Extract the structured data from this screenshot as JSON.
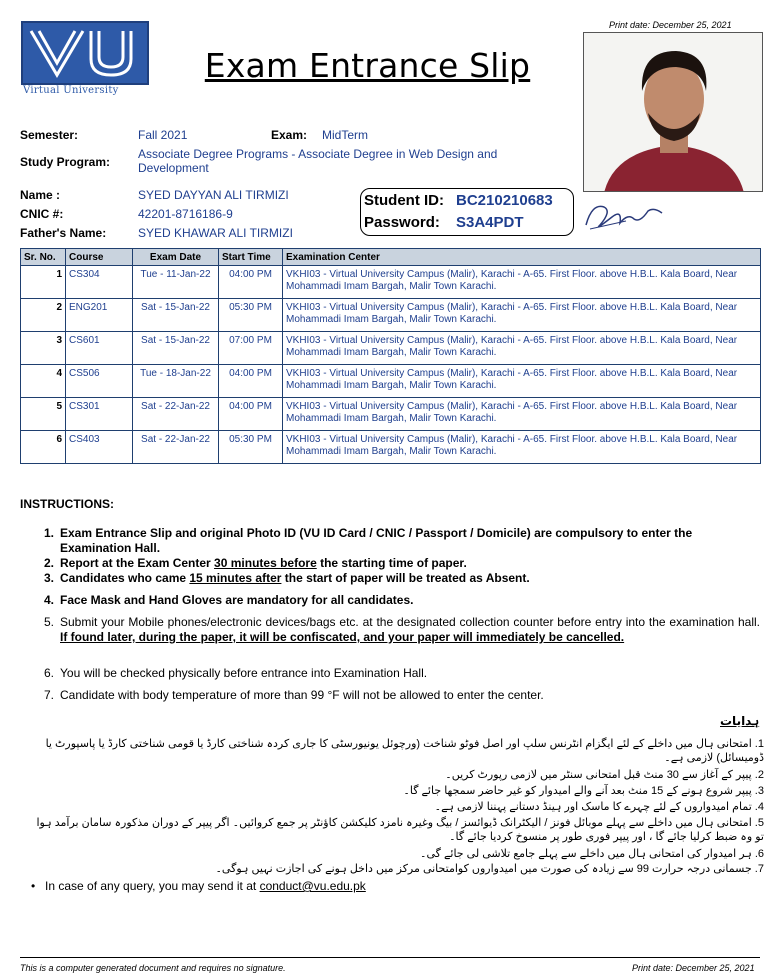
{
  "print_date": "Print date: December 25, 2021",
  "logo": {
    "caption": "Virtual University",
    "color": "#2e5aa8"
  },
  "title": "Exam Entrance Slip",
  "semester": {
    "label": "Semester:",
    "value": "Fall 2021"
  },
  "exam": {
    "label": "Exam:",
    "value": "MidTerm"
  },
  "study_program": {
    "label": "Study Program:",
    "value": "Associate Degree Programs - Associate Degree in Web Design and Development"
  },
  "name": {
    "label": "Name :",
    "value": "SYED DAYYAN ALI TIRMIZI"
  },
  "cnic": {
    "label": "CNIC #:",
    "value": "42201-8716186-9"
  },
  "father_name": {
    "label": "Father's Name:",
    "value": "SYED KHAWAR ALI TIRMIZI"
  },
  "student_id": {
    "label": "Student ID:",
    "value": "BC210210683"
  },
  "password": {
    "label": "Password:",
    "value": "S3A4PDT"
  },
  "table": {
    "headers": [
      "Sr. No.",
      "Course",
      "Exam Date",
      "Start Time",
      "Examination Center"
    ],
    "rows": [
      {
        "sr": "1",
        "course": "CS304",
        "date": "Tue - 11-Jan-22",
        "time": "04:00 PM",
        "center": "VKHI03 - Virtual University Campus (Malir), Karachi - A-65. First Floor. above H.B.L. Kala Board, Near Mohammadi Imam Bargah, Malir Town Karachi."
      },
      {
        "sr": "2",
        "course": "ENG201",
        "date": "Sat - 15-Jan-22",
        "time": "05:30 PM",
        "center": "VKHI03 - Virtual University Campus (Malir), Karachi - A-65. First Floor. above H.B.L. Kala Board, Near Mohammadi Imam Bargah, Malir Town Karachi."
      },
      {
        "sr": "3",
        "course": "CS601",
        "date": "Sat - 15-Jan-22",
        "time": "07:00 PM",
        "center": "VKHI03 - Virtual University Campus (Malir), Karachi - A-65. First Floor. above H.B.L. Kala Board, Near Mohammadi Imam Bargah, Malir Town Karachi."
      },
      {
        "sr": "4",
        "course": "CS506",
        "date": "Tue - 18-Jan-22",
        "time": "04:00 PM",
        "center": "VKHI03 - Virtual University Campus (Malir), Karachi - A-65. First Floor. above H.B.L. Kala Board, Near Mohammadi Imam Bargah, Malir Town Karachi."
      },
      {
        "sr": "5",
        "course": "CS301",
        "date": "Sat - 22-Jan-22",
        "time": "04:00 PM",
        "center": "VKHI03 - Virtual University Campus (Malir), Karachi - A-65. First Floor. above H.B.L. Kala Board, Near Mohammadi Imam Bargah, Malir Town Karachi."
      },
      {
        "sr": "6",
        "course": "CS403",
        "date": "Sat - 22-Jan-22",
        "time": "05:30 PM",
        "center": "VKHI03 - Virtual University Campus (Malir), Karachi - A-65. First Floor. above H.B.L. Kala Board, Near Mohammadi Imam Bargah, Malir Town Karachi."
      }
    ]
  },
  "instructions": {
    "heading": "INSTRUCTIONS:",
    "i1": "Exam Entrance Slip and original Photo ID (VU ID Card / CNIC / Passport / Domicile) are compulsory to enter the Examination Hall.",
    "i2_a": "Report at the Exam Center ",
    "i2_b": "30 minutes before",
    "i2_c": " the starting time of paper.",
    "i3_a": "Candidates who came ",
    "i3_b": "15 minutes after",
    "i3_c": " the start of paper will be treated as Absent.",
    "i4": "Face Mask and Hand Gloves are mandatory for all candidates.",
    "i5_a": "Submit your Mobile phones/electronic devices/bags etc. at the designated collection counter before entry into the examination hall. ",
    "i5_b": "If found later, during the paper, it will be confiscated, and your paper will immediately be cancelled.",
    "i6": "You will be checked physically before entrance into Examination Hall.",
    "i7": "Candidate with body temperature of more than 99 °F will not be allowed to enter the center."
  },
  "urdu": {
    "heading": "ہدایات",
    "u1": "1. امتحانی ہال میں داخلے کے لئے ایگزام انٹرنس سلپ اور اصل فوٹو شناخت (ورچوئل یونیورسٹی کا جاری کردہ شناختی کارڈ یا قومی شناختی کارڈ یا پاسپورٹ یا ڈومیسائل) لازمی ہے۔",
    "u2": "2. پیپر کے آغاز سے 30 منٹ قبل امتحانی سنٹر میں لازمی رپورٹ کریں۔",
    "u3": "3. پیپر شروع ہونے کے 15 منٹ بعد آنے والے امیدوار کو غیر حاضر سمجھا جائے گا۔",
    "u4": "4. تمام امیدواروں کے لئے چہرے کا ماسک اور ہینڈ دستانے پہننا لازمی ہے۔",
    "u5": "5. امتحانی ہال میں داخلے سے پہلے موبائل فونز / الیکٹرانک ڈیوائسز / بیگ وغیرہ نامزد کلیکشن کاؤنٹر پر جمع کروائیں۔ اگر پیپر کے دوران مذکورہ سامان برآمد ہوا تو وہ ضبط کرلیا جائے گا ، اور پیپر فوری طور پر منسوخ کردیا جائے گا۔",
    "u6": "6. ہر امیدوار کی امتحانی ہال میں داخلے سے پہلے جامع تلاشی لی جائے گی۔",
    "u7": "7. جسمانی درجہ حرارت 99 سے زیادہ کی صورت میں امیدواروں کوامتحانی مرکز میں داخل ہونے کی اجازت نہیں ہوگی۔"
  },
  "query": {
    "text": "In case of any query, you may send it at ",
    "email": "conduct@vu.edu.pk"
  },
  "footer": {
    "left": "This is a computer generated document and requires no signature.",
    "right": "Print date: December 25, 2021"
  }
}
